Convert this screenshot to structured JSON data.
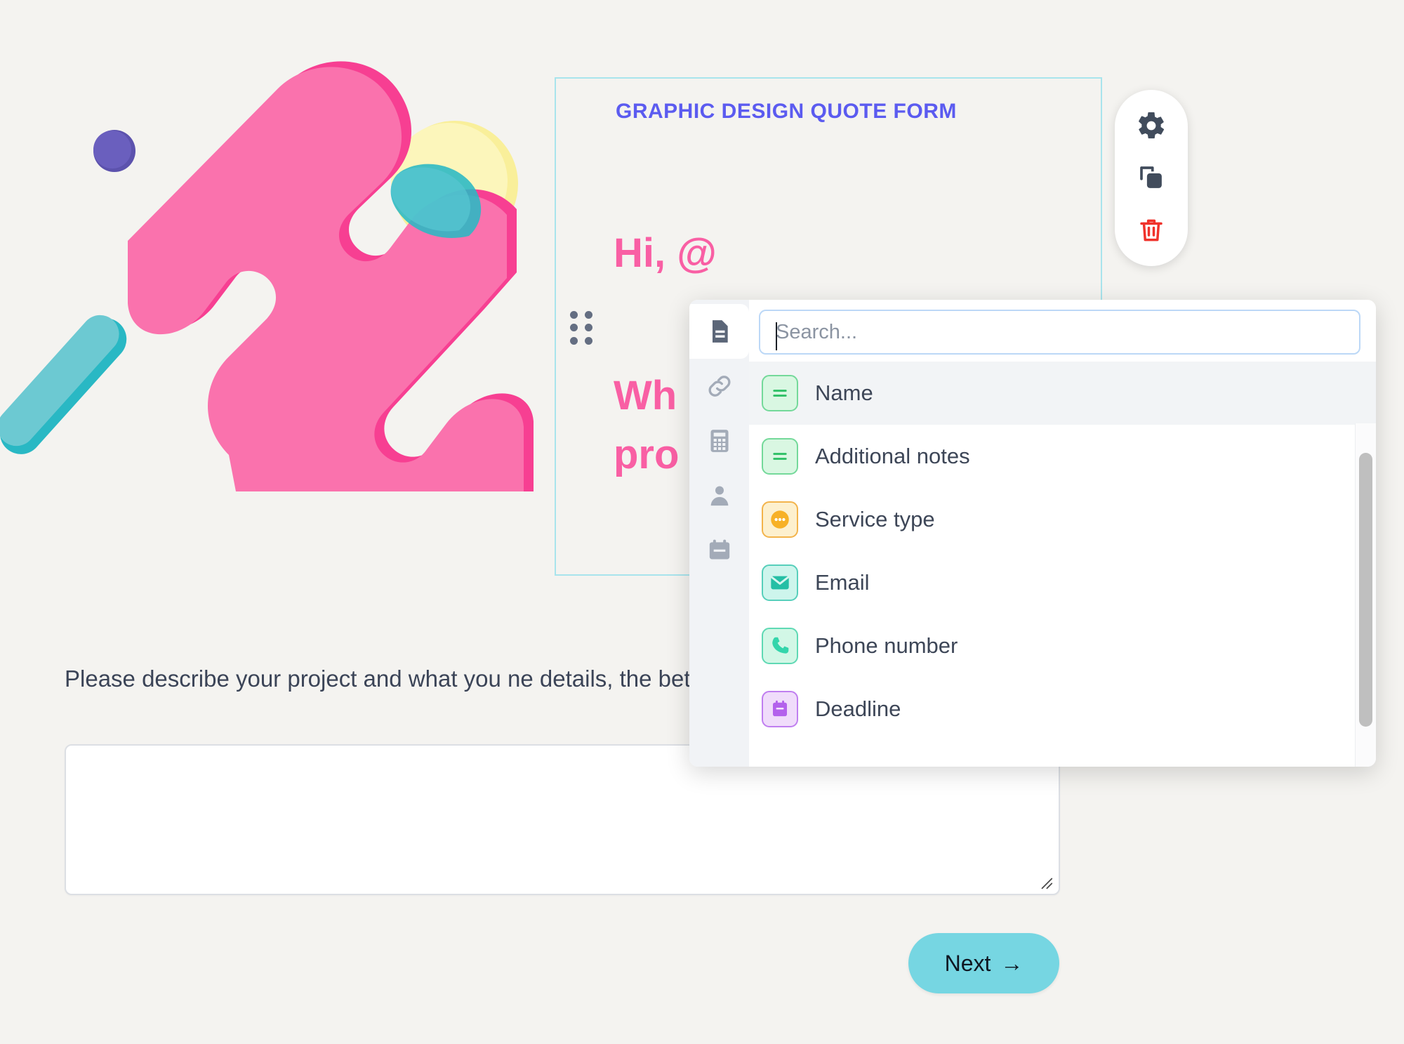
{
  "page": {
    "background_color": "#f4f3f0"
  },
  "form_card": {
    "title": "GRAPHIC DESIGN QUOTE FORM",
    "title_color": "#5b5bf0",
    "border_color": "#a8e4ec",
    "greeting": "Hi, @",
    "question": "Wh\npro",
    "accent_color": "#f95fa4",
    "drag_handle_name": "drag-handle"
  },
  "toolbar": {
    "settings_label": "gear-icon",
    "duplicate_label": "duplicate-icon",
    "delete_label": "trash-icon",
    "delete_color": "#f0322b",
    "icon_color": "#414c5c"
  },
  "description": {
    "text": "Please describe your project and what you ne\ndetails, the better!",
    "answer_value": "",
    "answer_placeholder": ""
  },
  "next_button": {
    "label": "Next",
    "arrow": "→",
    "color": "#76d6e2"
  },
  "panel": {
    "search": {
      "value": "",
      "placeholder": "Search..."
    },
    "rail": [
      {
        "name": "document-icon",
        "active": true
      },
      {
        "name": "link-icon",
        "active": false
      },
      {
        "name": "calculator-icon",
        "active": false
      },
      {
        "name": "person-icon",
        "active": false
      },
      {
        "name": "calendar-icon",
        "active": false
      }
    ],
    "options": [
      {
        "label": "Name",
        "icon": "text-lines-icon",
        "icon_style": "ico-green",
        "selected": true
      },
      {
        "label": "Additional notes",
        "icon": "text-lines-icon",
        "icon_style": "ico-green",
        "selected": false
      },
      {
        "label": "Service type",
        "icon": "choices-icon",
        "icon_style": "ico-amber",
        "selected": false
      },
      {
        "label": "Email",
        "icon": "envelope-icon",
        "icon_style": "ico-teal",
        "selected": false
      },
      {
        "label": "Phone number",
        "icon": "phone-icon",
        "icon_style": "ico-mint",
        "selected": false
      },
      {
        "label": "Deadline",
        "icon": "calendar-icon",
        "icon_style": "ico-purple",
        "selected": false
      }
    ]
  },
  "artwork": {
    "colors": {
      "pink_light": "#fa72ad",
      "pink_dark": "#f73f92",
      "purple_dot": "#5c52ad",
      "teal_bar": "#6cc9d2",
      "teal_dark": "#29b8c4",
      "yellow_circle": "#fbf3ae",
      "yellow_dark": "#f9ef9a"
    }
  }
}
